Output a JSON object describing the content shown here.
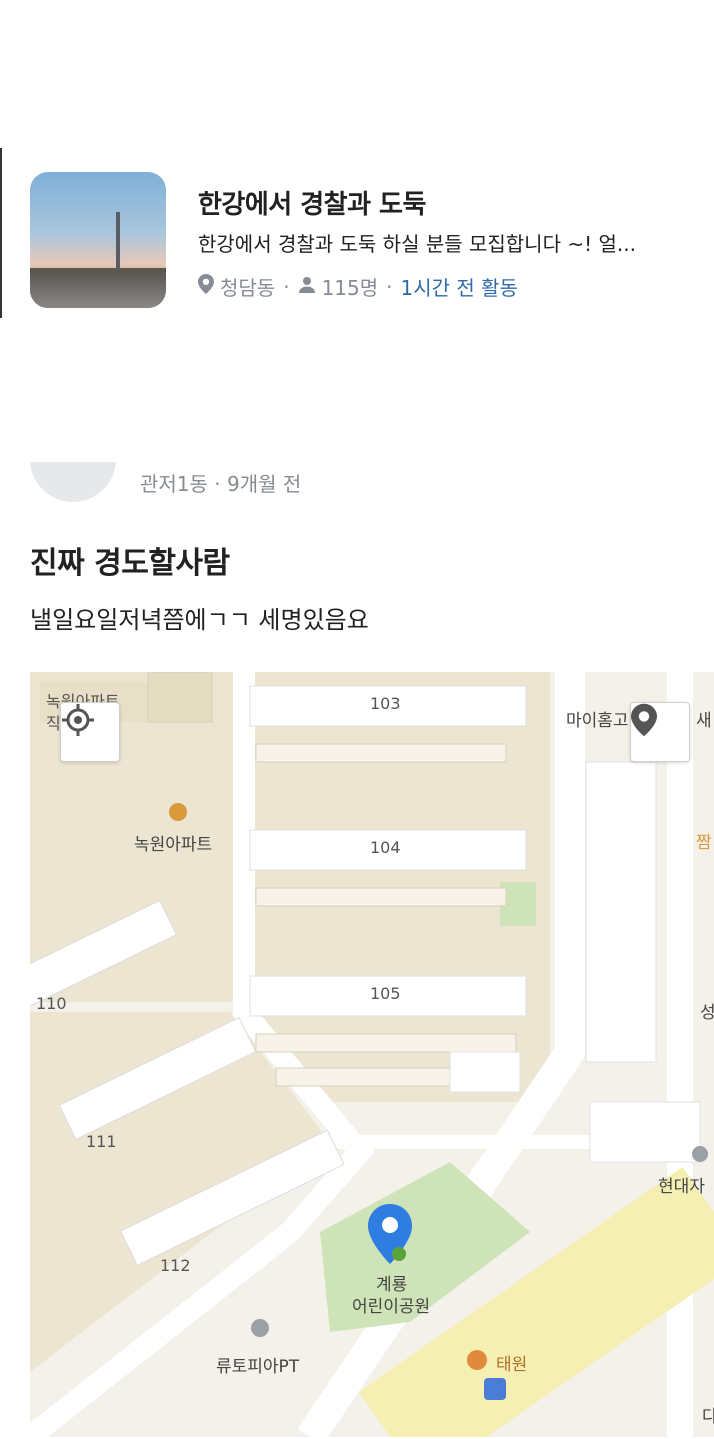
{
  "group": {
    "title": "한강에서 경찰과 도둑",
    "description": "한강에서 경찰과 도둑 하실 분들 모집합니다 ~! 얼...",
    "location": "청담동",
    "members": "115명",
    "activity": "1시간 전 활동"
  },
  "post": {
    "meta": "관저1동 · 9개월 전",
    "title": "진짜 경도할사람",
    "body": "낼일요일저녁쯤에ㄱㄱ 세명있음요"
  },
  "map": {
    "labels": {
      "apt_top": "녹원아파트",
      "apt_top_sub": "직    관",
      "apt": "녹원아파트",
      "b103": "103",
      "b104": "104",
      "b105": "105",
      "b110": "110",
      "b111": "111",
      "b112": "112",
      "myhome": "마이홈고",
      "sae": "새",
      "jjam": "짬",
      "seong": "성",
      "hyundai": "현대자",
      "park": "계룡\n어린이공원",
      "park_line1": "계룡",
      "park_line2": "어린이공원",
      "utopia": "류토피아PT",
      "taewon": "태원",
      "d": "다"
    },
    "colors": {
      "pin": "#2f7de1",
      "park": "#cfe3b8",
      "building": "#ffffff",
      "block": "#ece5d2",
      "road": "#ffffff",
      "highway": "#f6efb3"
    }
  }
}
